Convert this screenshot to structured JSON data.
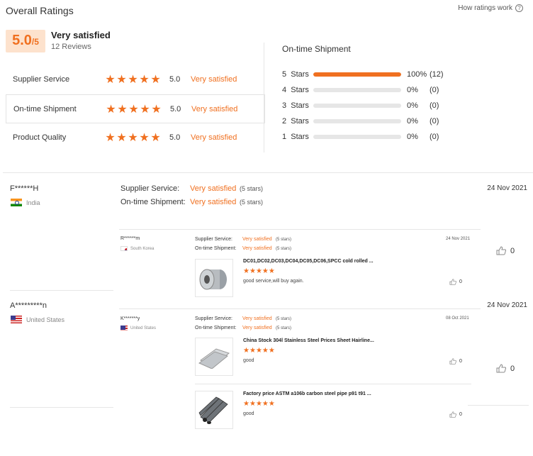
{
  "header": {
    "title": "Overall Ratings",
    "how_link": "How ratings work",
    "how_icon": "question-circle-icon"
  },
  "summary": {
    "score": "5.0",
    "score_suffix": "/5",
    "label": "Very satisfied",
    "reviews": "12 Reviews"
  },
  "categories": [
    {
      "label": "Supplier Service",
      "stars": 5,
      "value": "5.0",
      "text": "Very satisfied"
    },
    {
      "label": "On-time Shipment",
      "stars": 5,
      "value": "5.0",
      "text": "Very satisfied"
    },
    {
      "label": "Product Quality",
      "stars": 5,
      "value": "5.0",
      "text": "Very satisfied"
    }
  ],
  "shipment": {
    "title": "On-time Shipment",
    "rows": [
      {
        "label": "5  Stars",
        "fraction": 1.0,
        "pct": "100%",
        "count": "(12)"
      },
      {
        "label": "4  Stars",
        "fraction": 0,
        "pct": "0%",
        "count": "(0)"
      },
      {
        "label": "3  Stars",
        "fraction": 0,
        "pct": "0%",
        "count": "(0)"
      },
      {
        "label": "2  Stars",
        "fraction": 0,
        "pct": "0%",
        "count": "(0)"
      },
      {
        "label": "1  Stars",
        "fraction": 0,
        "pct": "0%",
        "count": "(0)"
      }
    ]
  },
  "reviews": [
    {
      "name": "F******H",
      "country": "India",
      "date": "24 Nov 2021",
      "supplier_label": "Supplier Service:",
      "supplier_value": "Very satisfied",
      "supplier_stars": "(5 stars)",
      "shipment_label": "On-time Shipment:",
      "shipment_value": "Very satisfied",
      "shipment_stars": "(5 stars)",
      "likes": "0",
      "nested": {
        "name": "R******m",
        "country": "South Korea",
        "date": "24 Nov 2021",
        "supplier_label": "Supplier Service:",
        "supplier_value": "Very satisfied",
        "supplier_stars": "(5 stars)",
        "shipment_label": "On-time Shipment:",
        "shipment_value": "Very satisfied",
        "shipment_stars": "(5 stars)",
        "product": "DC01,DC02,DC03,DC04,DC05,DC06,SPCC cold rolled ...",
        "comment": "good service,will buy again.",
        "likes": "0"
      }
    },
    {
      "name": "A*********n",
      "country": "United States",
      "date": "24 Nov 2021",
      "likes": "0",
      "nested": {
        "name": "K*******y",
        "country": "United States",
        "date": "08 Oct 2021",
        "supplier_label": "Supplier Service:",
        "supplier_value": "Very satisfied",
        "supplier_stars": "(5 stars)",
        "shipment_label": "On-time Shipment:",
        "shipment_value": "Very satisfied",
        "shipment_stars": "(5 stars)",
        "items": [
          {
            "product": "China Stock 304l Stainless Steel Prices Sheet Hairline...",
            "comment": "good",
            "likes": "0"
          },
          {
            "product": "Factory price ASTM a106b carbon steel pipe p91 t91 ...",
            "comment": "good",
            "likes": "0"
          }
        ]
      }
    }
  ],
  "colors": {
    "accent": "#f07020",
    "score_bg": "#fde2cd",
    "divider": "#e6e6e6"
  }
}
